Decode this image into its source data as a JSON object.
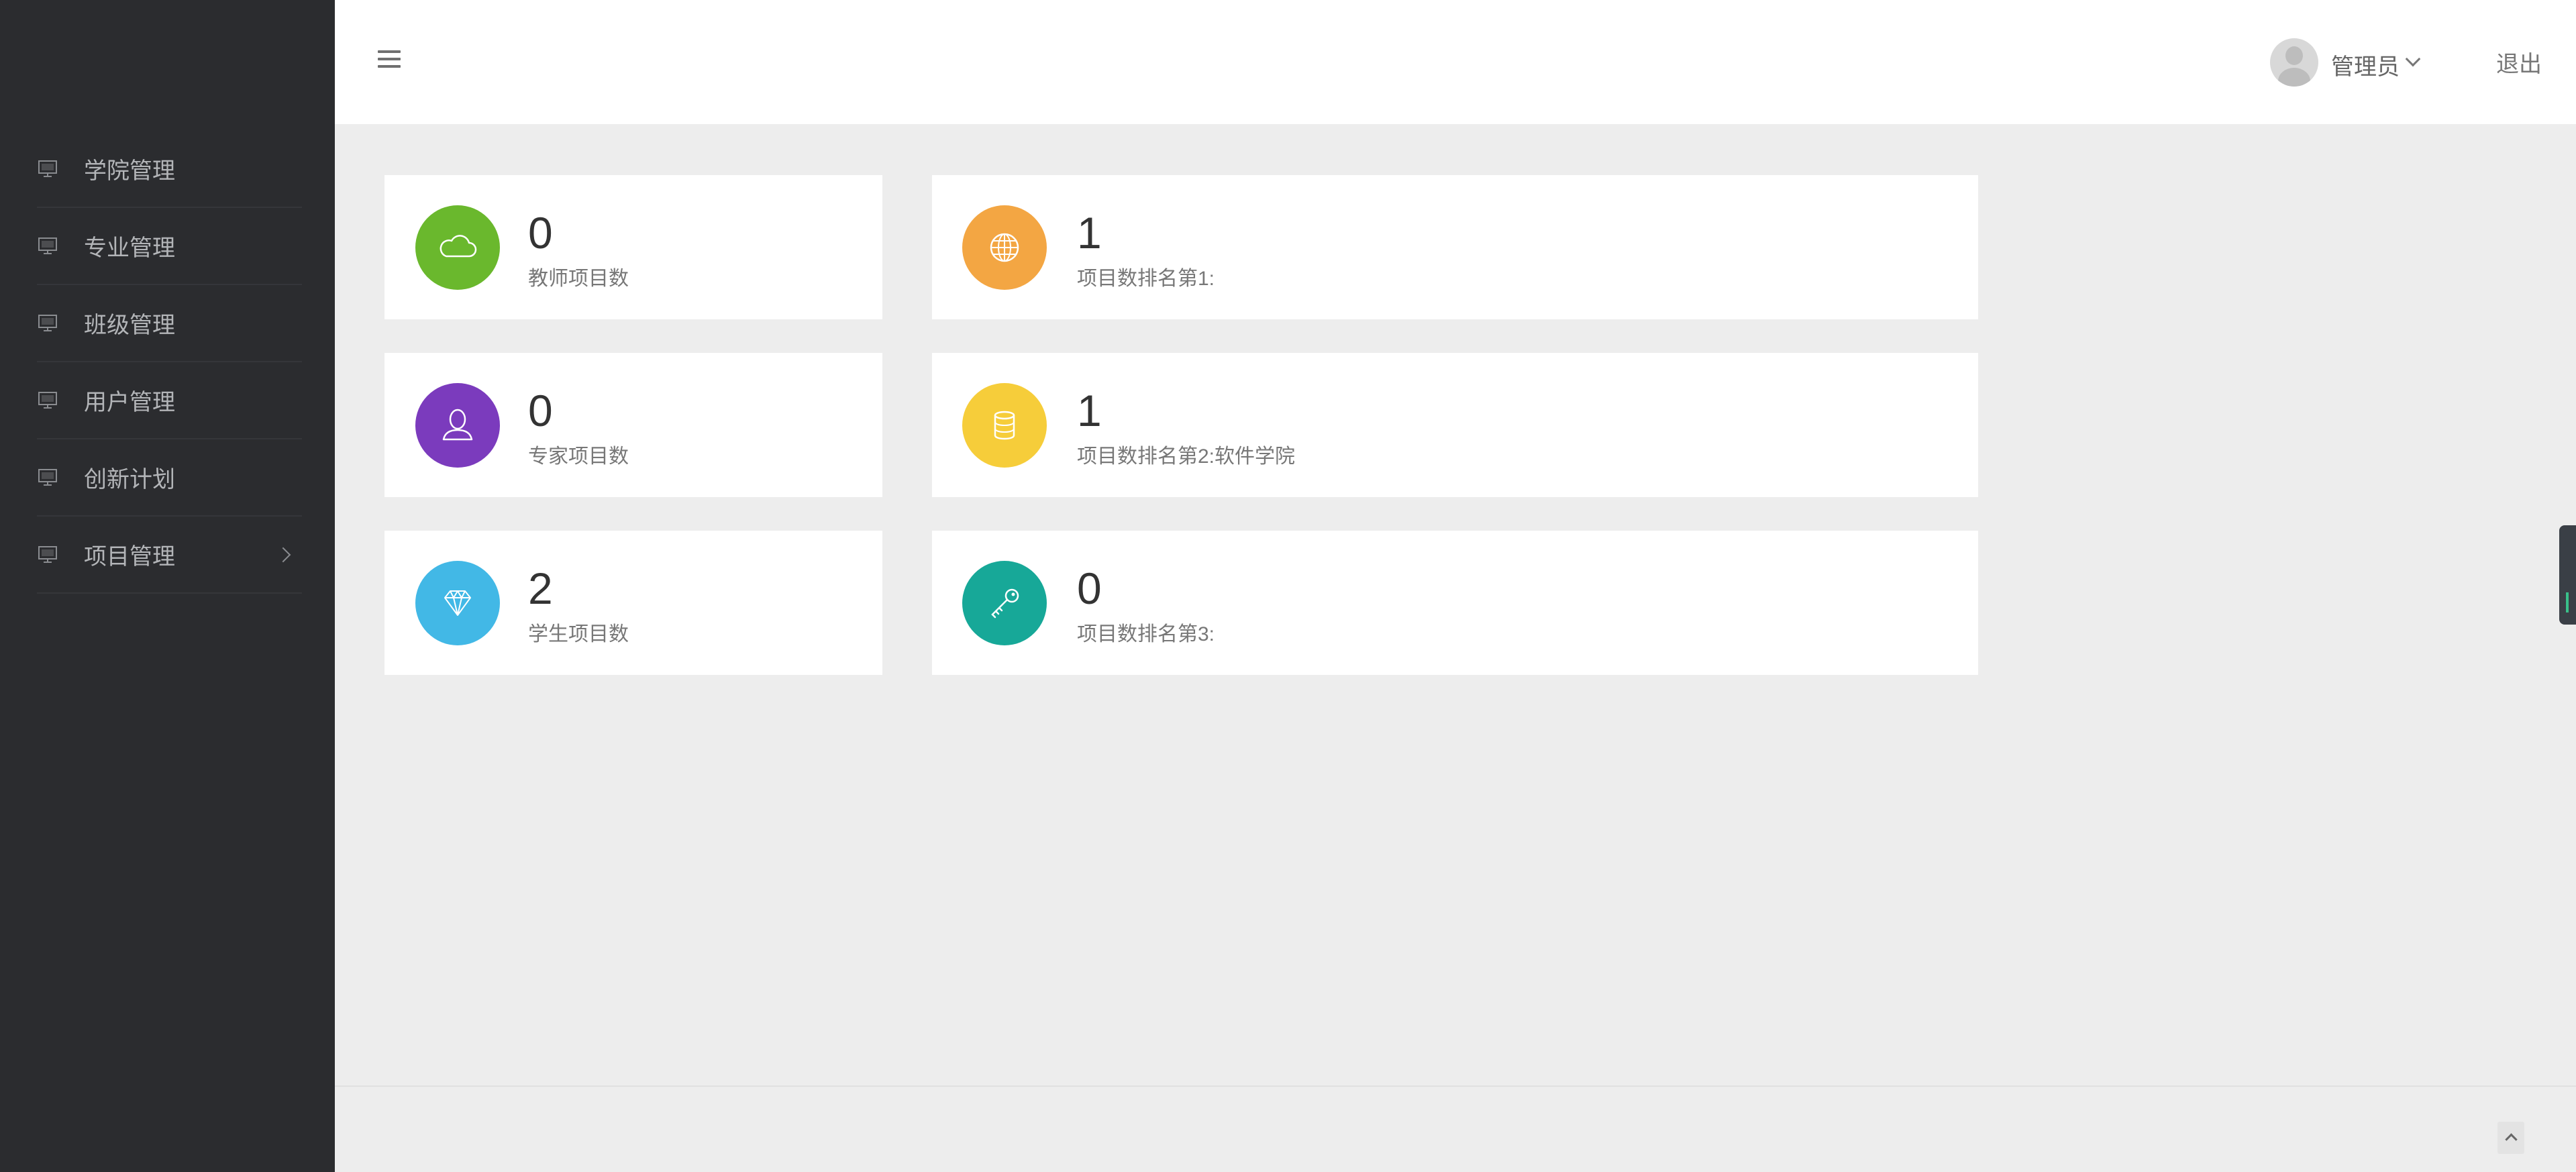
{
  "sidebar": {
    "items": [
      {
        "label": "学院管理",
        "icon": "monitor-icon"
      },
      {
        "label": "专业管理",
        "icon": "monitor-icon"
      },
      {
        "label": "班级管理",
        "icon": "monitor-icon"
      },
      {
        "label": "用户管理",
        "icon": "monitor-icon"
      },
      {
        "label": "创新计划",
        "icon": "monitor-icon"
      },
      {
        "label": "项目管理",
        "icon": "monitor-icon",
        "has_submenu": true
      }
    ]
  },
  "header": {
    "username": "管理员",
    "logout_label": "退出"
  },
  "stats": [
    {
      "value": "0",
      "label": "教师项目数",
      "icon": "cloud-icon",
      "color": "#6ab82d"
    },
    {
      "value": "0",
      "label": "专家项目数",
      "icon": "user-icon",
      "color": "#7b3bbd"
    },
    {
      "value": "2",
      "label": "学生项目数",
      "icon": "diamond-icon",
      "color": "#42b8e6"
    },
    {
      "value": "1",
      "label": "项目数排名第1:",
      "icon": "globe-icon",
      "color": "#f3a643"
    },
    {
      "value": "1",
      "label": "项目数排名第2:软件学院",
      "icon": "database-icon",
      "color": "#f6cd3a"
    },
    {
      "value": "0",
      "label": "项目数排名第3:",
      "icon": "key-icon",
      "color": "#17a898"
    }
  ]
}
